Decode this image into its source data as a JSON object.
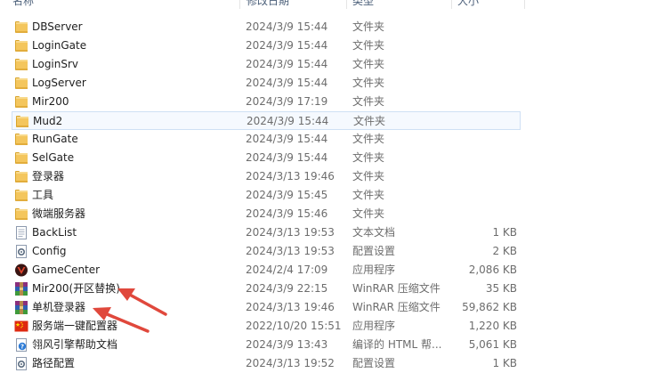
{
  "header": {
    "columns": [
      "名称",
      "修改日期",
      "类型",
      "大小"
    ]
  },
  "files": [
    {
      "name": "DBServer",
      "date": "2024/3/9 15:44",
      "type": "文件夹",
      "size": "",
      "icon": "folder-icon"
    },
    {
      "name": "LoginGate",
      "date": "2024/3/9 15:44",
      "type": "文件夹",
      "size": "",
      "icon": "folder-icon"
    },
    {
      "name": "LoginSrv",
      "date": "2024/3/9 15:44",
      "type": "文件夹",
      "size": "",
      "icon": "folder-icon"
    },
    {
      "name": "LogServer",
      "date": "2024/3/9 15:44",
      "type": "文件夹",
      "size": "",
      "icon": "folder-icon"
    },
    {
      "name": "Mir200",
      "date": "2024/3/9 17:19",
      "type": "文件夹",
      "size": "",
      "icon": "folder-icon"
    },
    {
      "name": "Mud2",
      "date": "2024/3/9 15:44",
      "type": "文件夹",
      "size": "",
      "icon": "folder-icon",
      "selected": true
    },
    {
      "name": "RunGate",
      "date": "2024/3/9 15:44",
      "type": "文件夹",
      "size": "",
      "icon": "folder-icon"
    },
    {
      "name": "SelGate",
      "date": "2024/3/9 15:44",
      "type": "文件夹",
      "size": "",
      "icon": "folder-icon"
    },
    {
      "name": "登录器",
      "date": "2024/3/13 19:46",
      "type": "文件夹",
      "size": "",
      "icon": "folder-icon"
    },
    {
      "name": "工具",
      "date": "2024/3/9 15:45",
      "type": "文件夹",
      "size": "",
      "icon": "folder-icon"
    },
    {
      "name": "微端服务器",
      "date": "2024/3/9 15:46",
      "type": "文件夹",
      "size": "",
      "icon": "folder-icon"
    },
    {
      "name": "BackList",
      "date": "2024/3/13 19:53",
      "type": "文本文档",
      "size": "1 KB",
      "icon": "text-document-icon"
    },
    {
      "name": "Config",
      "date": "2024/3/13 19:53",
      "type": "配置设置",
      "size": "2 KB",
      "icon": "config-settings-icon"
    },
    {
      "name": "GameCenter",
      "date": "2024/2/4 17:09",
      "type": "应用程序",
      "size": "2,086 KB",
      "icon": "game-center-app-icon"
    },
    {
      "name": "Mir200(开区替换)",
      "date": "2024/3/9 22:15",
      "type": "WinRAR 压缩文件",
      "size": "35 KB",
      "icon": "winrar-archive-icon"
    },
    {
      "name": "单机登录器",
      "date": "2024/3/13 19:46",
      "type": "WinRAR 压缩文件",
      "size": "59,862 KB",
      "icon": "winrar-archive-icon"
    },
    {
      "name": "服务端一键配置器",
      "date": "2022/10/20 15:51",
      "type": "应用程序",
      "size": "1,220 KB",
      "icon": "china-flag-app-icon"
    },
    {
      "name": "翎风引擎帮助文档",
      "date": "2024/3/9 13:43",
      "type": "编译的 HTML 帮...",
      "size": "5,061 KB",
      "icon": "help-document-icon"
    },
    {
      "name": "路径配置",
      "date": "2024/3/13 19:52",
      "type": "配置设置",
      "size": "1 KB",
      "icon": "config-settings-icon"
    }
  ],
  "annotations": {
    "arrow_color": "#e0483c"
  }
}
